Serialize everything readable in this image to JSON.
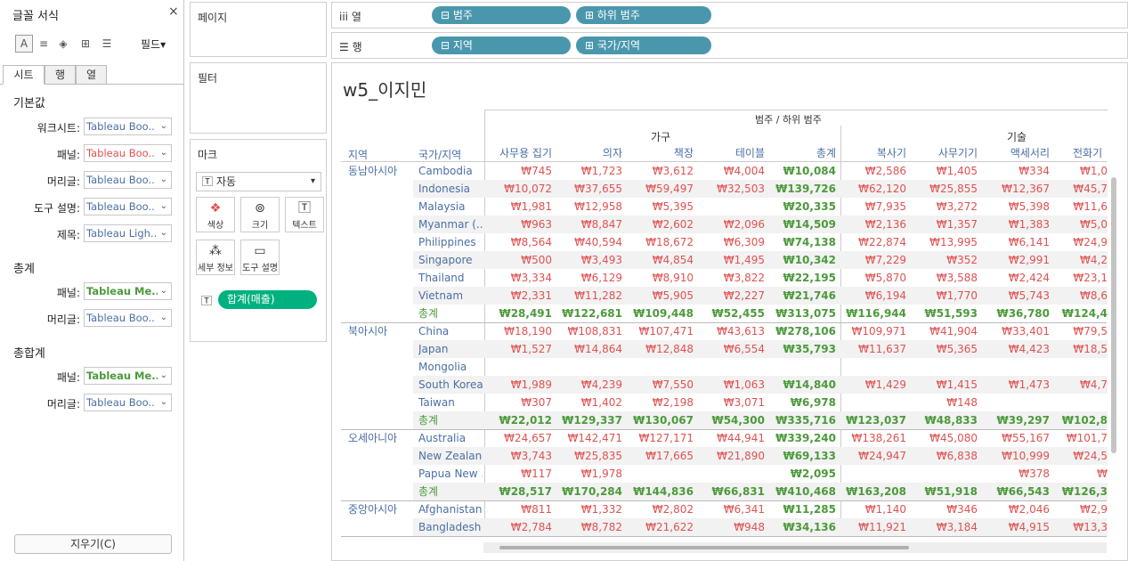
{
  "format_pane": {
    "title": "글꼴 서식",
    "close": "×",
    "fields_label": "필드▾",
    "tabs": [
      "시트",
      "행",
      "열"
    ],
    "sections": {
      "default": "기본값",
      "totals": "총계",
      "grand_totals": "총합계"
    },
    "default_rows": [
      {
        "label": "워크시트:",
        "value": "Tableau Boo..",
        "color": "#4a6fa5"
      },
      {
        "label": "패널:",
        "value": "Tableau Boo..",
        "color": "#e05252"
      },
      {
        "label": "머리글:",
        "value": "Tableau Boo..",
        "color": "#4a6fa5"
      },
      {
        "label": "도구 설명:",
        "value": "Tableau Boo..",
        "color": "#4a6fa5"
      },
      {
        "label": "제목:",
        "value": "Tableau Ligh..",
        "color": "#4a6fa5"
      }
    ],
    "total_rows": [
      {
        "label": "패널:",
        "value": "Tableau Me..",
        "color": "#4c9a3b"
      },
      {
        "label": "머리글:",
        "value": "Tableau Boo..",
        "color": "#4a6fa5"
      }
    ],
    "grand_rows": [
      {
        "label": "패널:",
        "value": "Tableau Me..",
        "color": "#4c9a3b"
      },
      {
        "label": "머리글:",
        "value": "Tableau Boo..",
        "color": "#4a6fa5"
      }
    ],
    "clear_label": "지우기(C)"
  },
  "cards": {
    "pages": "페이지",
    "filters": "필터",
    "marks": "마크",
    "mark_type": "자동",
    "mark_buttons": [
      "색상",
      "크기",
      "텍스트",
      "세부 정보",
      "도구 설명"
    ],
    "mark_pill": "합계(매출)"
  },
  "shelves": {
    "columns_label": "열",
    "rows_label": "행",
    "columns": [
      "범주",
      "하위 범주"
    ],
    "rows": [
      "지역",
      "국가/지역"
    ]
  },
  "view": {
    "title": "w5_이지민",
    "header_main": "범주 / 하위 범주",
    "cat_furniture": "가구",
    "cat_tech": "기술",
    "col_region": "지역",
    "col_country": "국가/지역",
    "furniture_cols": [
      "사무용 집기",
      "의자",
      "책장",
      "테이블",
      "총계"
    ],
    "tech_cols": [
      "복사기",
      "사무기기",
      "액세서리",
      "전화기"
    ],
    "total_label": "총계",
    "groups": [
      {
        "region": "동남아시아",
        "rows": [
          {
            "country": "Cambodia",
            "v": [
              "₩745",
              "₩1,723",
              "₩3,612",
              "₩4,004",
              "₩10,084",
              "₩2,586",
              "₩1,405",
              "₩334",
              "₩1,0"
            ]
          },
          {
            "country": "Indonesia",
            "v": [
              "₩10,072",
              "₩37,655",
              "₩59,497",
              "₩32,503",
              "₩139,726",
              "₩62,120",
              "₩25,855",
              "₩12,367",
              "₩45,7"
            ]
          },
          {
            "country": "Malaysia",
            "v": [
              "₩1,981",
              "₩12,958",
              "₩5,395",
              "",
              "₩20,335",
              "₩7,935",
              "₩3,272",
              "₩5,398",
              "₩11,6"
            ]
          },
          {
            "country": "Myanmar (..",
            "v": [
              "₩963",
              "₩8,847",
              "₩2,602",
              "₩2,096",
              "₩14,509",
              "₩2,136",
              "₩1,357",
              "₩1,383",
              "₩5,0"
            ]
          },
          {
            "country": "Philippines",
            "v": [
              "₩8,564",
              "₩40,594",
              "₩18,672",
              "₩6,309",
              "₩74,138",
              "₩22,874",
              "₩13,995",
              "₩6,141",
              "₩24,9"
            ]
          },
          {
            "country": "Singapore",
            "v": [
              "₩500",
              "₩3,493",
              "₩4,854",
              "₩1,495",
              "₩10,342",
              "₩7,229",
              "₩352",
              "₩2,991",
              "₩4,2"
            ]
          },
          {
            "country": "Thailand",
            "v": [
              "₩3,334",
              "₩6,129",
              "₩8,910",
              "₩3,822",
              "₩22,195",
              "₩5,870",
              "₩3,588",
              "₩2,424",
              "₩23,1"
            ]
          },
          {
            "country": "Vietnam",
            "v": [
              "₩2,331",
              "₩11,282",
              "₩5,905",
              "₩2,227",
              "₩21,746",
              "₩6,194",
              "₩1,770",
              "₩5,743",
              "₩8,6"
            ]
          }
        ],
        "total": [
          "₩28,491",
          "₩122,681",
          "₩109,448",
          "₩52,455",
          "₩313,075",
          "₩116,944",
          "₩51,593",
          "₩36,780",
          "₩124,4"
        ]
      },
      {
        "region": "북아시아",
        "rows": [
          {
            "country": "China",
            "v": [
              "₩18,190",
              "₩108,831",
              "₩107,471",
              "₩43,613",
              "₩278,106",
              "₩109,971",
              "₩41,904",
              "₩33,401",
              "₩79,5"
            ]
          },
          {
            "country": "Japan",
            "v": [
              "₩1,527",
              "₩14,864",
              "₩12,848",
              "₩6,554",
              "₩35,793",
              "₩11,637",
              "₩5,365",
              "₩4,423",
              "₩18,5"
            ]
          },
          {
            "country": "Mongolia",
            "v": [
              "",
              "",
              "",
              "",
              "",
              "",
              "",
              "",
              ""
            ]
          },
          {
            "country": "South Korea",
            "v": [
              "₩1,989",
              "₩4,239",
              "₩7,550",
              "₩1,063",
              "₩14,840",
              "₩1,429",
              "₩1,415",
              "₩1,473",
              "₩4,7"
            ]
          },
          {
            "country": "Taiwan",
            "v": [
              "₩307",
              "₩1,402",
              "₩2,198",
              "₩3,071",
              "₩6,978",
              "",
              "₩148",
              "",
              ""
            ]
          }
        ],
        "total": [
          "₩22,012",
          "₩129,337",
          "₩130,067",
          "₩54,300",
          "₩335,716",
          "₩123,037",
          "₩48,833",
          "₩39,297",
          "₩102,8"
        ]
      },
      {
        "region": "오세아니아",
        "rows": [
          {
            "country": "Australia",
            "v": [
              "₩24,657",
              "₩142,471",
              "₩127,171",
              "₩44,941",
              "₩339,240",
              "₩138,261",
              "₩45,080",
              "₩55,167",
              "₩101,7"
            ]
          },
          {
            "country": "New Zealand",
            "v": [
              "₩3,743",
              "₩25,835",
              "₩17,665",
              "₩21,890",
              "₩69,133",
              "₩24,947",
              "₩6,838",
              "₩10,999",
              "₩24,5"
            ]
          },
          {
            "country": "Papua New ..",
            "v": [
              "₩117",
              "₩1,978",
              "",
              "",
              "₩2,095",
              "",
              "",
              "₩378",
              "₩"
            ]
          }
        ],
        "total": [
          "₩28,517",
          "₩170,284",
          "₩144,836",
          "₩66,831",
          "₩410,468",
          "₩163,208",
          "₩51,918",
          "₩66,543",
          "₩126,3"
        ]
      },
      {
        "region": "중앙아시아",
        "rows": [
          {
            "country": "Afghanistan",
            "v": [
              "₩811",
              "₩1,332",
              "₩2,802",
              "₩6,341",
              "₩11,285",
              "₩1,140",
              "₩346",
              "₩2,046",
              "₩2,9"
            ]
          },
          {
            "country": "Bangladesh",
            "v": [
              "₩2,784",
              "₩8,782",
              "₩21,622",
              "₩948",
              "₩34,136",
              "₩11,921",
              "₩3,184",
              "₩4,915",
              "₩13,3"
            ]
          }
        ]
      }
    ]
  },
  "colors": {
    "pill": "#4a97ad",
    "measure_pill": "#00b180",
    "value_red": "#e05252",
    "total_green": "#4c9a3b",
    "link_blue": "#4a6fa5"
  }
}
